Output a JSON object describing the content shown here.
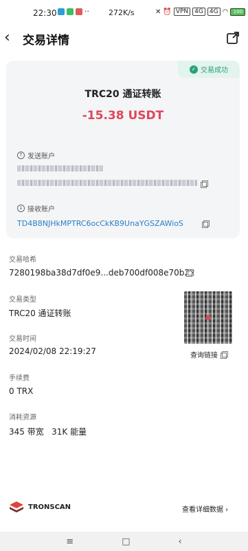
{
  "status_bar": {
    "time": "22:30",
    "speed": "272K/s",
    "vpn": "VPN",
    "signal1": "4G",
    "signal2": "4G",
    "battery": "100",
    "more": "··"
  },
  "header": {
    "title": "交易详情",
    "back_icon": "chevron-left-icon",
    "share_icon": "external-link-icon"
  },
  "summary": {
    "status_badge": "交易成功",
    "tx_title": "TRC20 通证转账",
    "amount": "-15.38 USDT",
    "sender_label": "发送账户",
    "receiver_label": "接收账户",
    "receiver_address": "TD4B8NJHkMPTRC6ocCkKB9UnaYGSZAWioS"
  },
  "details": {
    "hash_label": "交易哈希",
    "hash_value": "7280198ba38d7df0e9...deb700df008e70b22",
    "type_label": "交易类型",
    "type_value": "TRC20 通证转账",
    "time_label": "交易时间",
    "time_value": "2024/02/08 22:19:27",
    "fee_label": "手续费",
    "fee_value": "0 TRX",
    "resource_label": "消耗资源",
    "resource_value": "345 带宽   31K 能量",
    "qr_link": "查询链接"
  },
  "footer": {
    "brand_name": "TRONSCAN",
    "details_link": "查看详细数据 ›"
  },
  "system_nav": {
    "menu": "≡",
    "home": "□",
    "back": "‹"
  },
  "colors": {
    "amount": "#e0465a",
    "success": "#27a17a",
    "link": "#2a7fc6",
    "card_bg": "#f4f5f6"
  }
}
